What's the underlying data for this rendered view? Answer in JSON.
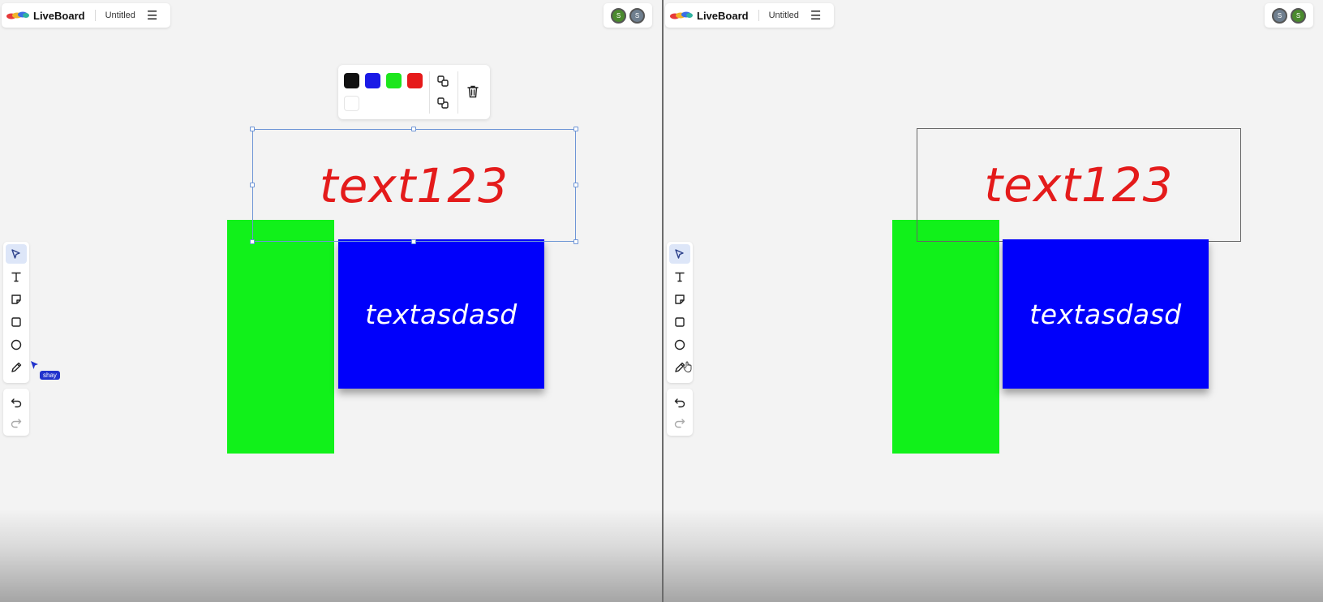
{
  "app": {
    "brand": "LiveBoard",
    "doc_title": "Untitled"
  },
  "colors": {
    "black": "#111111",
    "blue": "#1a1ae6",
    "green": "#1de61d",
    "red": "#e61a1a",
    "white": "#ffffff",
    "shape_green": "#11f11a",
    "shape_blue": "#0000fb",
    "text_red": "#e41b1b",
    "selection": "#6e95d6"
  },
  "left_pane": {
    "avatars": [
      {
        "initial": "S",
        "color": "#4a8a2e"
      },
      {
        "initial": "S",
        "color": "#6f7f8f"
      }
    ],
    "canvas": {
      "red_text": "text123",
      "blue_text": "textasdasd"
    },
    "cursor_label": "shay"
  },
  "right_pane": {
    "avatars": [
      {
        "initial": "S",
        "color": "#6f7f8f"
      },
      {
        "initial": "S",
        "color": "#4a8a2e"
      }
    ],
    "canvas": {
      "red_text": "text123",
      "blue_text": "textasdasd"
    }
  },
  "toolbar": {
    "tools": [
      "select-icon",
      "text-icon",
      "sticky-note-icon",
      "rectangle-icon",
      "ellipse-icon",
      "pencil-icon"
    ],
    "history": [
      "undo-icon",
      "redo-icon"
    ]
  },
  "palette": {
    "swatches": [
      "black",
      "blue",
      "green",
      "red",
      "white"
    ],
    "actions": [
      "bring-forward-icon",
      "send-backward-icon",
      "trash-icon"
    ]
  }
}
